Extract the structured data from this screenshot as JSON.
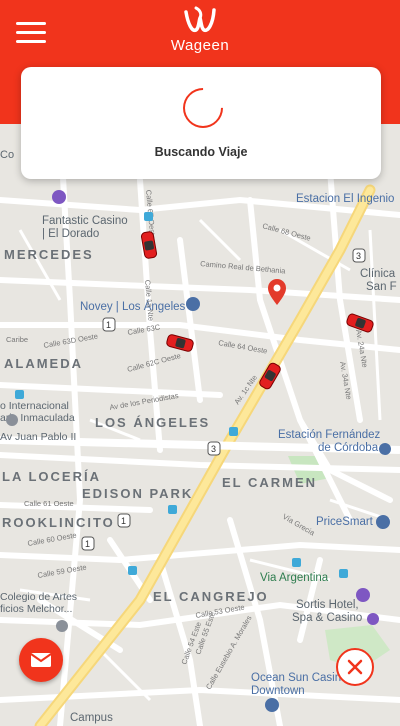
{
  "header": {
    "brand": "Wageen",
    "brand_color": "#f1341c",
    "menu_icon": "hamburger-icon"
  },
  "search_card": {
    "status_text": "Buscando Viaje",
    "spinner_icon": "loading-spinner-icon"
  },
  "map": {
    "neighborhoods": [
      "MERCEDES",
      "ALAMEDA",
      "LOS ÁNGELES",
      "LA LOCERÍA",
      "EDISON PARK",
      "EL CARMEN",
      "ROOKLINCITO",
      "EL CANGREJO"
    ],
    "places": [
      "Fantastic Casino\n| El Dorado",
      "Novey | Los Ángeles",
      "Estacion El Ingenio",
      "Clínica\nSan F",
      "Estación Fernández\nde Córdoba",
      "PriceSmart",
      "Via Argentina",
      "Sortis Hotel,\nSpa & Casino",
      "Ocean Sun Casino\nDowntown",
      "Colegio de Artes\nficios Melchor...",
      "Campus",
      "o Internacional\naria Inmaculada",
      "Av Juan Pablo II",
      "Co",
      "Caribe"
    ],
    "streets": [
      "Camino Real de Bethania",
      "Calle 64 Oeste",
      "Calle 63C",
      "Calle 62C Oeste",
      "Av de los Periodistas",
      "Calle 61 Oeste",
      "Calle 60 Oeste",
      "Calle 59 Oeste",
      "Calle 53 Oeste",
      "Calle 68 Oeste",
      "Vía Grecia",
      "Av. 24a Nte",
      "Av. 34a Nte",
      "Calle Eusebio A. Morales",
      "Av. 1c Nte",
      "Calle 63D Oeste",
      "Calle 1a Nte",
      "Calle 67 Oeste",
      "Calle 55 Este",
      "Calle 54 Este"
    ],
    "route_markers": [
      "1",
      "3",
      "3",
      "1",
      "1"
    ],
    "pin_icon": "location-pin-icon",
    "car_icon": "car-icon"
  },
  "actions": {
    "mail_icon": "mail-icon",
    "close_icon": "close-icon"
  }
}
